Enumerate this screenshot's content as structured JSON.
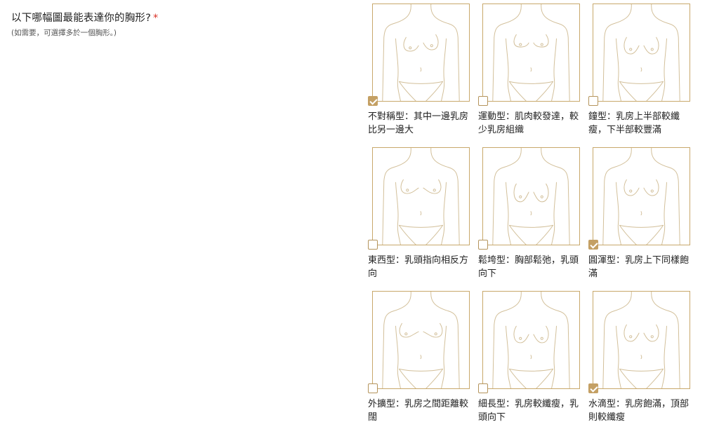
{
  "question": {
    "text": "以下哪幅圖最能表達你的胸形?",
    "required_mark": "*",
    "hint": "(如需要，可選擇多於一個胸形。)"
  },
  "accent_color": "#c4a064",
  "options": [
    {
      "label": "不對稱型：其中一邊乳房比另一邊大",
      "checked": true
    },
    {
      "label": "運動型：肌肉較發達，較少乳房組織",
      "checked": false
    },
    {
      "label": "鐘型：乳房上半部較纖瘦，下半部較豐滿",
      "checked": false
    },
    {
      "label": "東西型：乳頭指向相反方向",
      "checked": false
    },
    {
      "label": "鬆垮型：胸部鬆弛，乳頭向下",
      "checked": false
    },
    {
      "label": "圓渾型：乳房上下同樣飽滿",
      "checked": true
    },
    {
      "label": "外擴型：乳房之間距離較闊",
      "checked": false
    },
    {
      "label": "細長型：乳房較纖瘦，乳頭向下",
      "checked": false
    },
    {
      "label": "水滴型：乳房飽滿，頂部則較纖瘦",
      "checked": true
    }
  ]
}
